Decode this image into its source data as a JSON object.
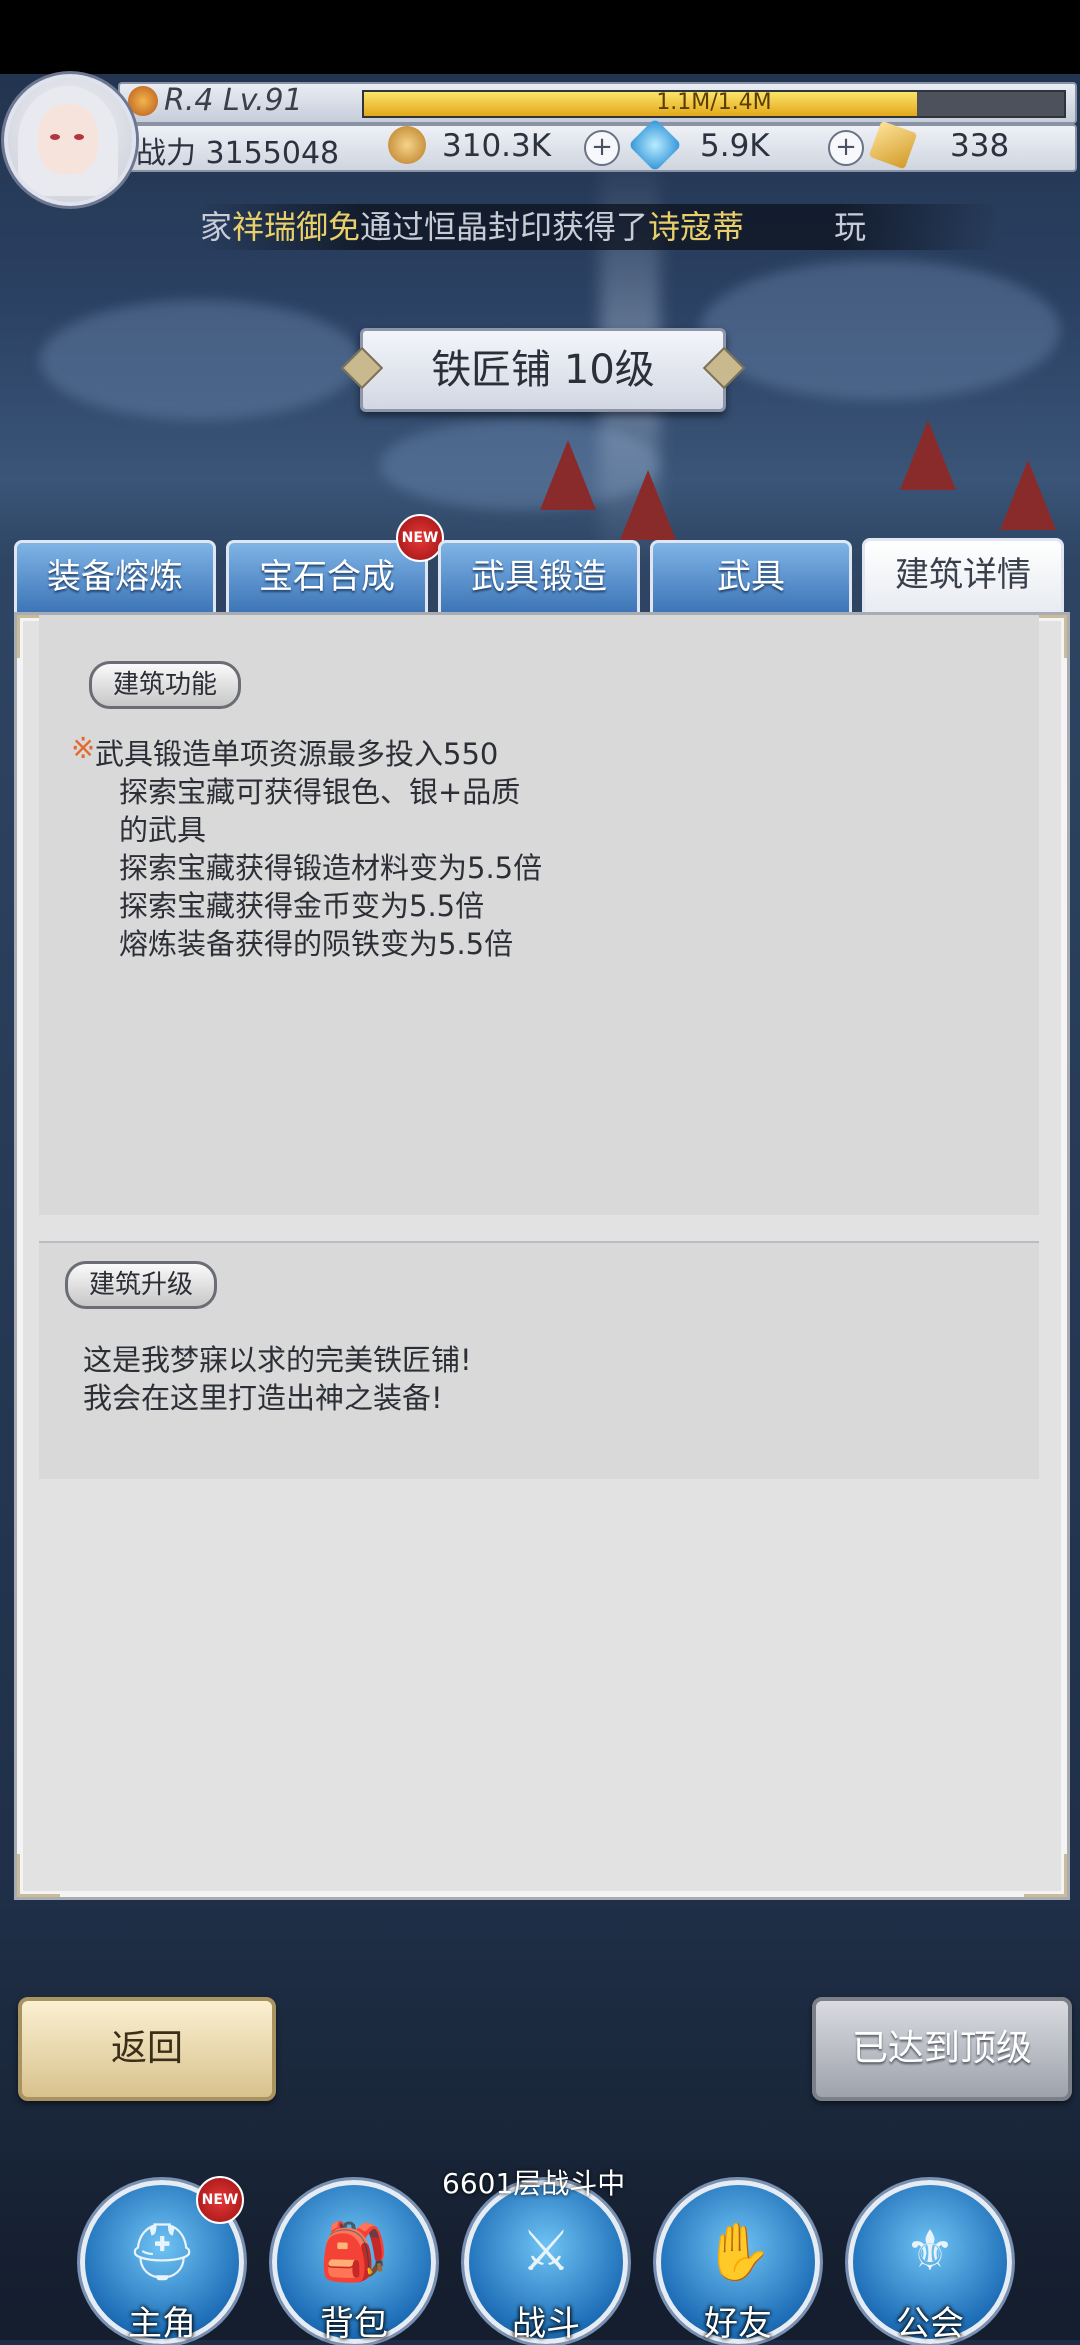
{
  "hud": {
    "rank_level": "R.4 Lv.91",
    "exp_text": "1.1M/1.4M",
    "exp_fraction": 0.79,
    "power": "战力 3155048",
    "gold": "310.3K",
    "gems": "5.9K",
    "tickets": "338",
    "ticker": {
      "prefix": "家",
      "name1": "祥瑞御免",
      "middle": "通过恒晶封印获得了",
      "name2": "诗寇蒂",
      "suffix": "玩"
    }
  },
  "building_title": "铁匠铺 10级",
  "tabs": [
    {
      "label": "装备熔炼"
    },
    {
      "label": "宝石合成",
      "badge": "NEW"
    },
    {
      "label": "武具锻造"
    },
    {
      "label": "武具"
    },
    {
      "label": "建筑详情",
      "active": true
    }
  ],
  "function_section": {
    "label": "建筑功能",
    "mark": "※",
    "lines": [
      "武具锻造单项资源最多投入550",
      "探索宝藏可获得银色、银+品质",
      "的武具",
      "探索宝藏获得锻造材料变为5.5倍",
      "探索宝藏获得金币变为5.5倍",
      "熔炼装备获得的陨铁变为5.5倍"
    ]
  },
  "upgrade_section": {
    "label": "建筑升级",
    "lines": [
      "这是我梦寐以求的完美铁匠铺!",
      "我会在这里打造出神之装备!"
    ]
  },
  "buttons": {
    "back": "返回",
    "max_level": "已达到顶级"
  },
  "battle_status": "6601层战斗中",
  "nav": [
    {
      "label": "主角",
      "icon": "hero-helmet-icon",
      "badge": "NEW"
    },
    {
      "label": "背包",
      "icon": "backpack-icon"
    },
    {
      "label": "战斗",
      "icon": "crossed-swords-icon"
    },
    {
      "label": "好友",
      "icon": "handshake-icon"
    },
    {
      "label": "公会",
      "icon": "guild-emblem-icon"
    }
  ],
  "colors": {
    "tab_blue": "#3c74b6",
    "exp_gold": "#e3a819",
    "highlight_mark": "#e26a2f"
  }
}
